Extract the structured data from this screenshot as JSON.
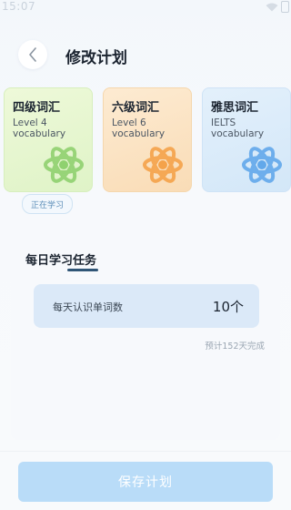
{
  "status_bar": {
    "time": "15:07"
  },
  "header": {
    "title": "修改计划"
  },
  "plans": [
    {
      "title": "四级词汇",
      "subtitle_line1": "Level 4",
      "subtitle_line2": "vocabulary",
      "icon": "atom-icon",
      "color": "#8fd16f"
    },
    {
      "title": "六级词汇",
      "subtitle_line1": "Level 6",
      "subtitle_line2": "vocabulary",
      "icon": "atom-icon",
      "color": "#f4a24a"
    },
    {
      "title": "雅思词汇",
      "subtitle_line1": "IELTS",
      "subtitle_line2": "vocabulary",
      "icon": "atom-icon",
      "color": "#62a8ea"
    }
  ],
  "current_badge": "正在学习",
  "task": {
    "title": "每日学习任务",
    "daily_label": "每天认识单词数",
    "daily_value": "10个",
    "estimate": "预计152天完成"
  },
  "footer": {
    "save_label": "保存计划"
  }
}
